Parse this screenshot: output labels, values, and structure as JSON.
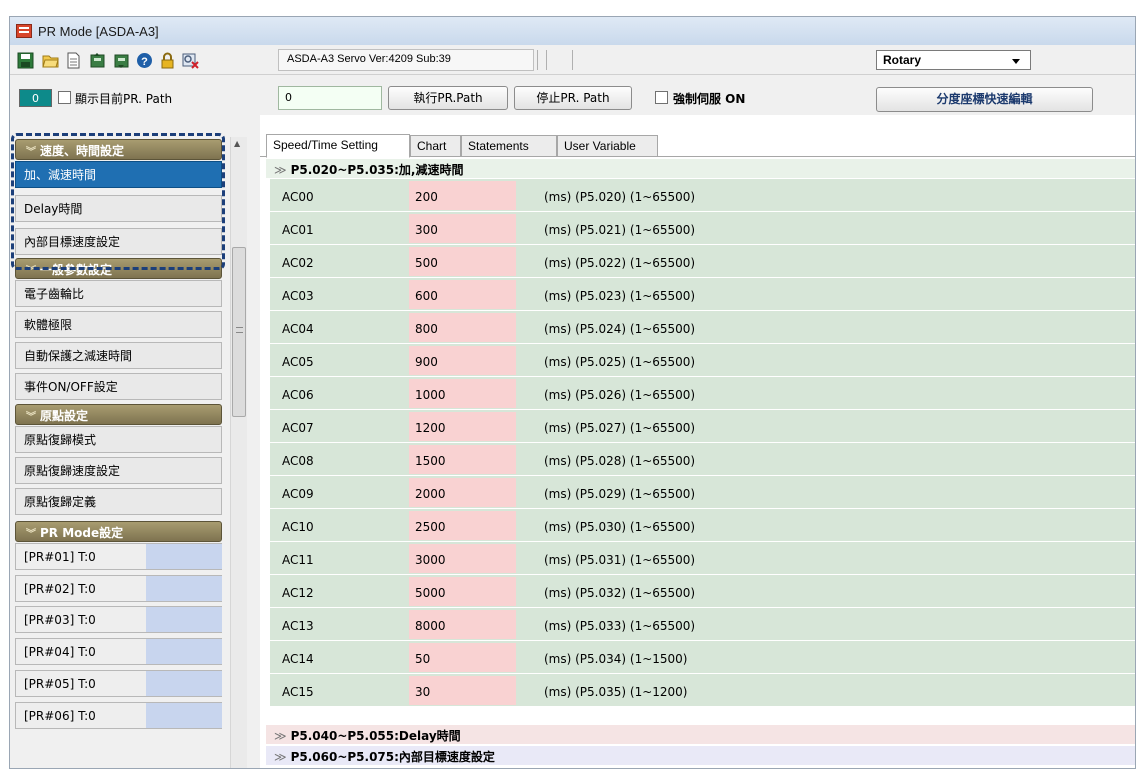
{
  "window": {
    "title": "PR Mode [ASDA-A3]"
  },
  "toolbar": {
    "icons": [
      "save-icon",
      "open-folder-icon",
      "document-icon",
      "read-from-drive-icon",
      "write-to-drive-icon",
      "help-icon",
      "lock-icon",
      "close-connection-icon"
    ],
    "version_text": "ASDA-A3 Servo Ver:4209 Sub:39",
    "mode_select": {
      "value": "Rotary"
    }
  },
  "controls": {
    "pr_number": "0",
    "show_path_label": "顯示目前PR. Path",
    "path_input_value": "0",
    "run_button": "執行PR.Path",
    "stop_button": "停止PR. Path",
    "force_servo_label": "強制伺服 ON",
    "index_edit_button": "分度座標快速編輯"
  },
  "sidebar": {
    "groups": [
      {
        "header": "速度、時間設定",
        "items": [
          "加、減速時間",
          "Delay時間",
          "內部目標速度設定"
        ]
      },
      {
        "header": "一般參數設定",
        "items": [
          "電子齒輪比",
          "軟體極限",
          "自動保護之減速時間",
          "事件ON/OFF設定"
        ]
      },
      {
        "header": "原點設定",
        "items": [
          "原點復歸模式",
          "原點復歸速度設定",
          "原點復歸定義"
        ]
      },
      {
        "header": "PR Mode設定",
        "items": [
          "[PR#01]   T:0",
          "[PR#02]   T:0",
          "[PR#03]   T:0",
          "[PR#04]   T:0",
          "[PR#05]   T:0",
          "[PR#06]   T:0"
        ]
      }
    ],
    "active_item": "加、減速時間"
  },
  "tabs": [
    "Speed/Time Setting",
    "Chart",
    "Statements",
    "User Variable"
  ],
  "active_tab": "Speed/Time Setting",
  "sections": {
    "accel": "P5.020~P5.035:加,減速時間",
    "delay": "P5.040~P5.055:Delay時間",
    "speed": "P5.060~P5.075:內部目標速度設定"
  },
  "params": [
    {
      "name": "AC00",
      "value": "200",
      "desc": "(ms)  (P5.020)  (1~65500)"
    },
    {
      "name": "AC01",
      "value": "300",
      "desc": "(ms)  (P5.021)  (1~65500)"
    },
    {
      "name": "AC02",
      "value": "500",
      "desc": "(ms)  (P5.022)  (1~65500)"
    },
    {
      "name": "AC03",
      "value": "600",
      "desc": "(ms)  (P5.023)  (1~65500)"
    },
    {
      "name": "AC04",
      "value": "800",
      "desc": "(ms)  (P5.024)  (1~65500)"
    },
    {
      "name": "AC05",
      "value": "900",
      "desc": "(ms)  (P5.025)  (1~65500)"
    },
    {
      "name": "AC06",
      "value": "1000",
      "desc": "(ms)  (P5.026)  (1~65500)"
    },
    {
      "name": "AC07",
      "value": "1200",
      "desc": "(ms)  (P5.027)  (1~65500)"
    },
    {
      "name": "AC08",
      "value": "1500",
      "desc": "(ms)  (P5.028)  (1~65500)"
    },
    {
      "name": "AC09",
      "value": "2000",
      "desc": "(ms)  (P5.029)  (1~65500)"
    },
    {
      "name": "AC10",
      "value": "2500",
      "desc": "(ms)  (P5.030)  (1~65500)"
    },
    {
      "name": "AC11",
      "value": "3000",
      "desc": "(ms)  (P5.031)  (1~65500)"
    },
    {
      "name": "AC12",
      "value": "5000",
      "desc": "(ms)  (P5.032)  (1~65500)"
    },
    {
      "name": "AC13",
      "value": "8000",
      "desc": "(ms)  (P5.033)  (1~65500)"
    },
    {
      "name": "AC14",
      "value": "50",
      "desc": "(ms)  (P5.034)  (1~1500)"
    },
    {
      "name": "AC15",
      "value": "30",
      "desc": "(ms)  (P5.035)  (1~1200)"
    }
  ]
}
